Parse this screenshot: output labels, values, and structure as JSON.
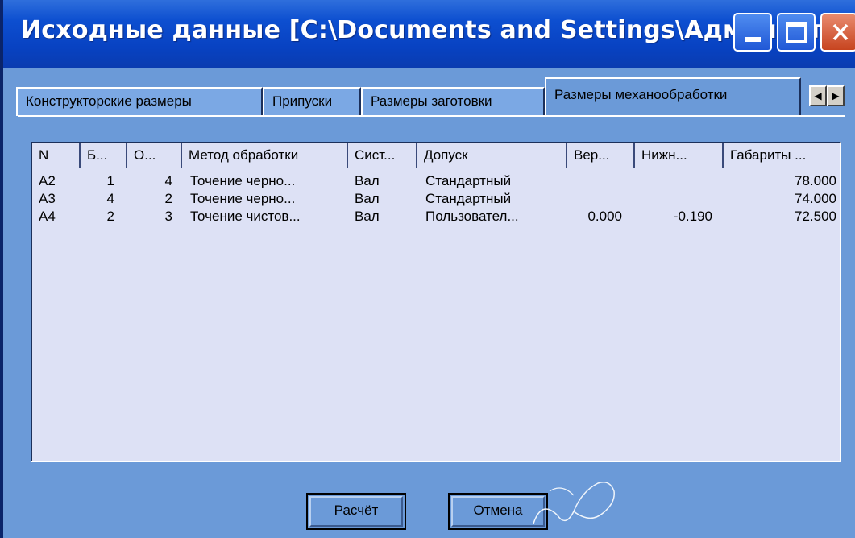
{
  "window": {
    "title": "Исходные данные [C:\\Documents and Settings\\Админист…"
  },
  "tabs": [
    {
      "label": "Конструкторские размеры",
      "active": false
    },
    {
      "label": "Припуски",
      "active": false
    },
    {
      "label": "Размеры заготовки",
      "active": false
    },
    {
      "label": "Размеры механообработки",
      "active": true
    }
  ],
  "tab_scroll": {
    "left": "◀",
    "right": "▶"
  },
  "table": {
    "columns": [
      "N",
      "Б...",
      "О...",
      "Метод обработки",
      "Сист...",
      "Допуск",
      "Вер...",
      "Нижн...",
      "Габариты ..."
    ],
    "rows": [
      [
        "А2",
        "1",
        "4",
        "Точение черно...",
        "Вал",
        "Стандартный",
        "",
        "",
        "78.000"
      ],
      [
        "А3",
        "4",
        "2",
        "Точение черно...",
        "Вал",
        "Стандартный",
        "",
        "",
        "74.000"
      ],
      [
        "А4",
        "2",
        "3",
        "Точение чистов...",
        "Вал",
        "Пользовател...",
        "0.000",
        "-0.190",
        "72.500"
      ]
    ]
  },
  "buttons": {
    "calculate": "Расчёт",
    "cancel": "Отмена"
  },
  "colors": {
    "titlebar": "#0842c2",
    "window_bg": "#6b9ad8",
    "list_bg": "#dde1f5"
  }
}
